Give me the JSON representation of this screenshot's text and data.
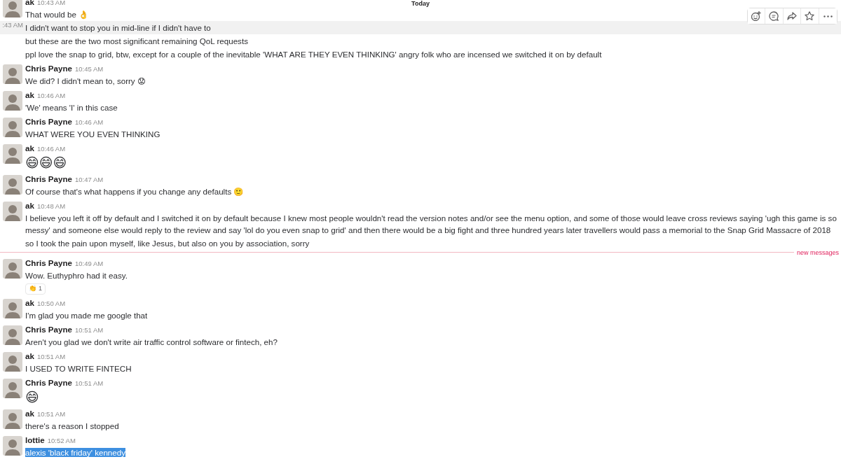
{
  "day_label": "Today",
  "toolbar": {
    "buttons": [
      {
        "kind": "add-reaction"
      },
      {
        "kind": "thread"
      },
      {
        "kind": "share"
      },
      {
        "kind": "star"
      },
      {
        "kind": "more"
      }
    ]
  },
  "feed": [
    {
      "kind": "group",
      "author": "ak",
      "time": "10:43 AM",
      "messages": [
        {
          "kind": "text",
          "text": "That would be 👌",
          "hovered": false,
          "selected": false
        },
        {
          "kind": "text",
          "text": "I didn't want to stop you in mid-line if I didn't have to",
          "hover_time": ":43 AM",
          "hovered": true,
          "selected": false
        },
        {
          "kind": "text",
          "text": "but these are the two most significant remaining QoL requests",
          "hovered": false,
          "selected": false
        },
        {
          "kind": "text",
          "text": "ppl love the snap to grid, btw, except for a couple of the inevitable 'WHAT ARE THEY EVEN THINKING' angry folk who are incensed we switched it on by default",
          "hovered": false,
          "selected": false
        }
      ]
    },
    {
      "kind": "group",
      "author": "Chris Payne",
      "time": "10:45 AM",
      "messages": [
        {
          "kind": "text",
          "text": "We did? I didn't mean to, sorry 😟",
          "hovered": false,
          "selected": false
        }
      ]
    },
    {
      "kind": "group",
      "author": "ak",
      "time": "10:46 AM",
      "messages": [
        {
          "kind": "text",
          "text": "'We' means 'I' in this case",
          "hovered": false,
          "selected": false
        }
      ]
    },
    {
      "kind": "group",
      "author": "Chris Payne",
      "time": "10:46 AM",
      "messages": [
        {
          "kind": "text",
          "text": "WHAT WERE YOU EVEN THINKING",
          "hovered": false,
          "selected": false
        }
      ]
    },
    {
      "kind": "group",
      "author": "ak",
      "time": "10:46 AM",
      "messages": [
        {
          "kind": "emoji",
          "text": "😄😄😄",
          "hovered": false,
          "selected": false
        }
      ]
    },
    {
      "kind": "group",
      "author": "Chris Payne",
      "time": "10:47 AM",
      "messages": [
        {
          "kind": "text",
          "text": "Of course that's what happens if you change any defaults 🙂",
          "hovered": false,
          "selected": false
        }
      ]
    },
    {
      "kind": "group",
      "author": "ak",
      "time": "10:48 AM",
      "messages": [
        {
          "kind": "text",
          "text": "I believe you left it off by default and I switched it on by default because I knew most people wouldn't read the version notes and/or see the menu option, and some of those would leave cross reviews saying 'ugh this game is so messy' and someone else would reply to the review and say 'lol do you even snap to grid' and then there would be a big fight and three hundred years later travellers would pass a memorial to the Snap Grid Massacre of 2018",
          "hovered": false,
          "selected": false
        },
        {
          "kind": "text",
          "text": "so I took the pain upon myself, like Jesus, but also on you by association, sorry",
          "hovered": false,
          "selected": false
        }
      ]
    },
    {
      "kind": "divider",
      "label": "new messages"
    },
    {
      "kind": "group",
      "author": "Chris Payne",
      "time": "10:49 AM",
      "messages": [
        {
          "kind": "text",
          "text": "Wow. Euthyphro had it easy.",
          "hovered": false,
          "selected": false,
          "reactions": [
            {
              "emoji": "👏",
              "count": "1"
            }
          ]
        }
      ]
    },
    {
      "kind": "group",
      "author": "ak",
      "time": "10:50 AM",
      "messages": [
        {
          "kind": "text",
          "text": "I'm glad you made me google that",
          "hovered": false,
          "selected": false
        }
      ]
    },
    {
      "kind": "group",
      "author": "Chris Payne",
      "time": "10:51 AM",
      "messages": [
        {
          "kind": "text",
          "text": "Aren't you glad we don't write air traffic control software or fintech, eh?",
          "hovered": false,
          "selected": false
        }
      ]
    },
    {
      "kind": "group",
      "author": "ak",
      "time": "10:51 AM",
      "messages": [
        {
          "kind": "text",
          "text": "I USED TO WRITE FINTECH",
          "hovered": false,
          "selected": false
        }
      ]
    },
    {
      "kind": "group",
      "author": "Chris Payne",
      "time": "10:51 AM",
      "messages": [
        {
          "kind": "emoji",
          "text": "😄",
          "hovered": false,
          "selected": false
        }
      ]
    },
    {
      "kind": "group",
      "author": "ak",
      "time": "10:51 AM",
      "messages": [
        {
          "kind": "text",
          "text": "there's a reason I stopped",
          "hovered": false,
          "selected": false
        }
      ]
    },
    {
      "kind": "group",
      "author": "lottie",
      "time": "10:52 AM",
      "messages": [
        {
          "kind": "text",
          "text": "alexis 'black friday' kennedy",
          "hovered": false,
          "selected": true
        }
      ]
    }
  ]
}
